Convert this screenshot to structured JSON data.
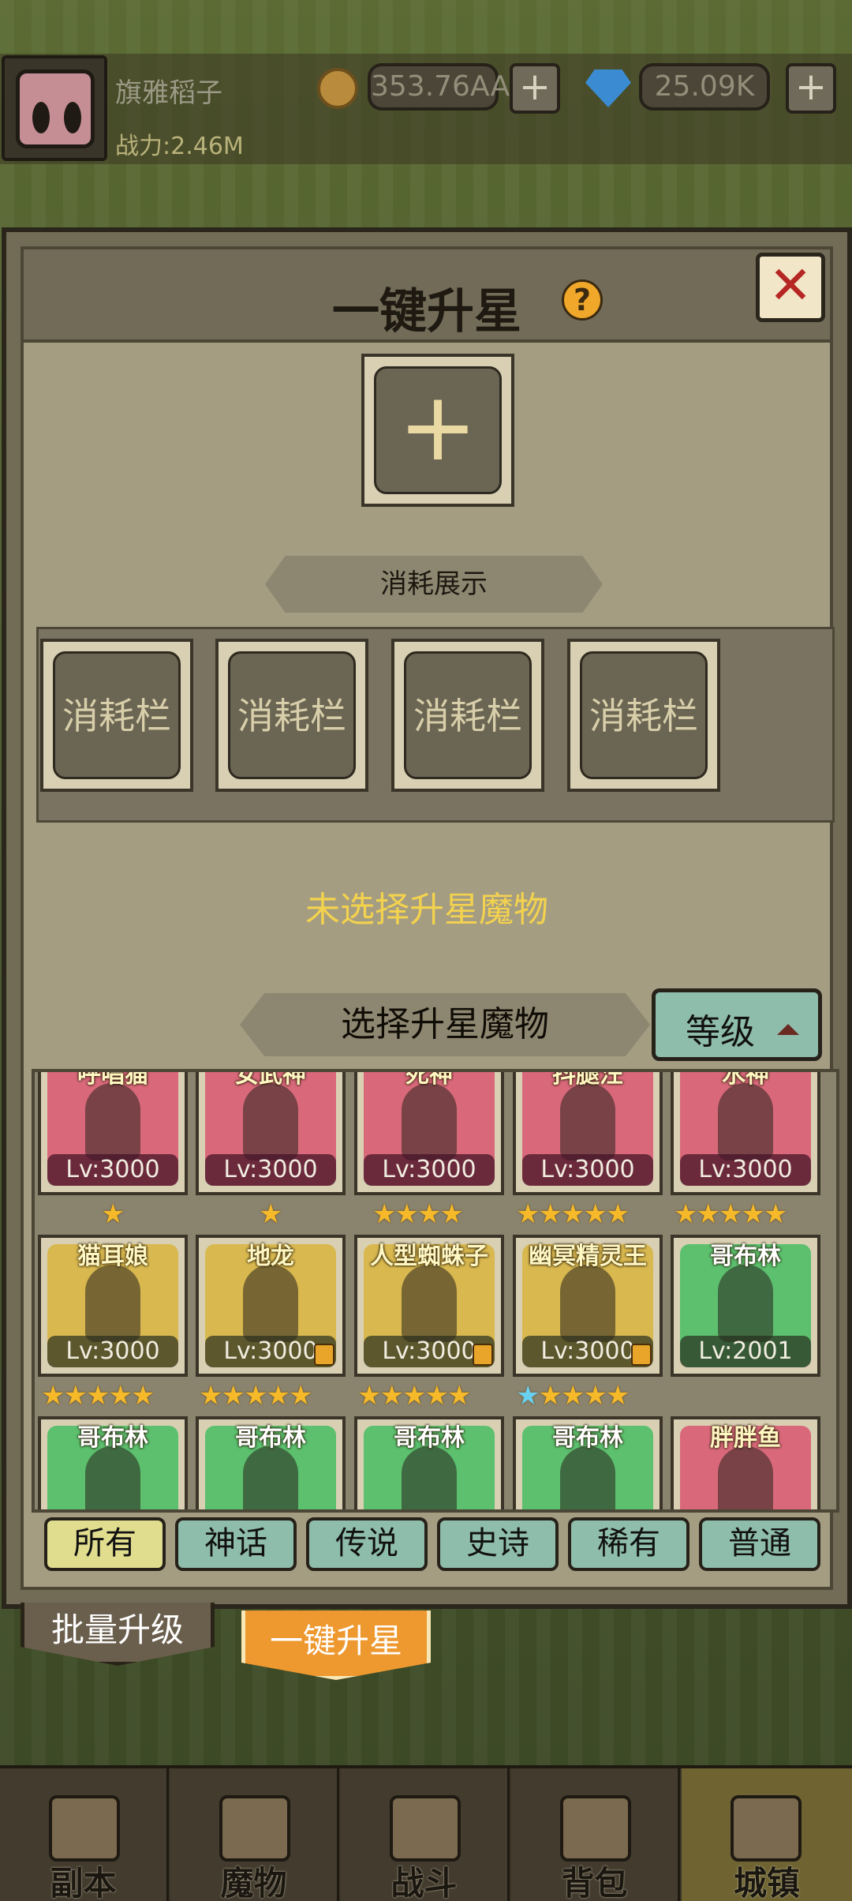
{
  "player": {
    "name": "旗雅稻子",
    "power": "战力:2.46M"
  },
  "resources": {
    "coins": "353.76AA",
    "gems": "25.09K",
    "plus": "+"
  },
  "modal": {
    "title": "一键升星",
    "help": "?",
    "close": "✕",
    "main_slot": "+",
    "consume_title": "消耗展示",
    "consume_slots": [
      "消耗栏",
      "消耗栏",
      "消耗栏",
      "消耗栏"
    ],
    "empty_notice": "未选择升星魔物",
    "select_title": "选择升星魔物",
    "sort_label": "等级"
  },
  "monsters": [
    {
      "name": "呼唱猫",
      "lv": "Lv:3000",
      "color": "red",
      "stars": 1,
      "blue": 0,
      "lock": false
    },
    {
      "name": "女武神",
      "lv": "Lv:3000",
      "color": "red",
      "stars": 1,
      "blue": 0,
      "lock": false
    },
    {
      "name": "死神",
      "lv": "Lv:3000",
      "color": "red",
      "stars": 4,
      "blue": 0,
      "lock": false
    },
    {
      "name": "抖腿汪",
      "lv": "Lv:3000",
      "color": "red",
      "stars": 5,
      "blue": 0,
      "lock": false
    },
    {
      "name": "水神",
      "lv": "Lv:3000",
      "color": "red",
      "stars": 5,
      "blue": 0,
      "lock": false
    },
    {
      "name": "猫耳娘",
      "lv": "Lv:3000",
      "color": "yellow",
      "stars": 5,
      "blue": 0,
      "lock": false
    },
    {
      "name": "地龙",
      "lv": "Lv:3000",
      "color": "yellow",
      "stars": 5,
      "blue": 0,
      "lock": true
    },
    {
      "name": "人型蜘蛛子",
      "lv": "Lv:3000",
      "color": "yellow",
      "stars": 5,
      "blue": 0,
      "lock": true
    },
    {
      "name": "幽冥精灵王",
      "lv": "Lv:3000",
      "color": "yellow",
      "stars": 4,
      "blue": 1,
      "lock": true
    },
    {
      "name": "哥布林",
      "lv": "Lv:2001",
      "color": "green",
      "stars": 0,
      "blue": 0,
      "lock": false
    },
    {
      "name": "哥布林",
      "lv": "",
      "color": "green",
      "stars": 0,
      "blue": 0,
      "lock": false
    },
    {
      "name": "哥布林",
      "lv": "",
      "color": "green",
      "stars": 0,
      "blue": 0,
      "lock": false
    },
    {
      "name": "哥布林",
      "lv": "",
      "color": "green",
      "stars": 0,
      "blue": 0,
      "lock": false
    },
    {
      "name": "哥布林",
      "lv": "",
      "color": "green",
      "stars": 0,
      "blue": 0,
      "lock": false
    },
    {
      "name": "胖胖鱼",
      "lv": "",
      "color": "red",
      "stars": 0,
      "blue": 0,
      "lock": false
    }
  ],
  "filter_tabs": [
    "所有",
    "神话",
    "传说",
    "史诗",
    "稀有",
    "普通"
  ],
  "actions": {
    "batch": "批量升级",
    "onekey": "一键升星"
  },
  "nav": [
    "副本",
    "魔物",
    "战斗",
    "背包",
    "城镇"
  ]
}
